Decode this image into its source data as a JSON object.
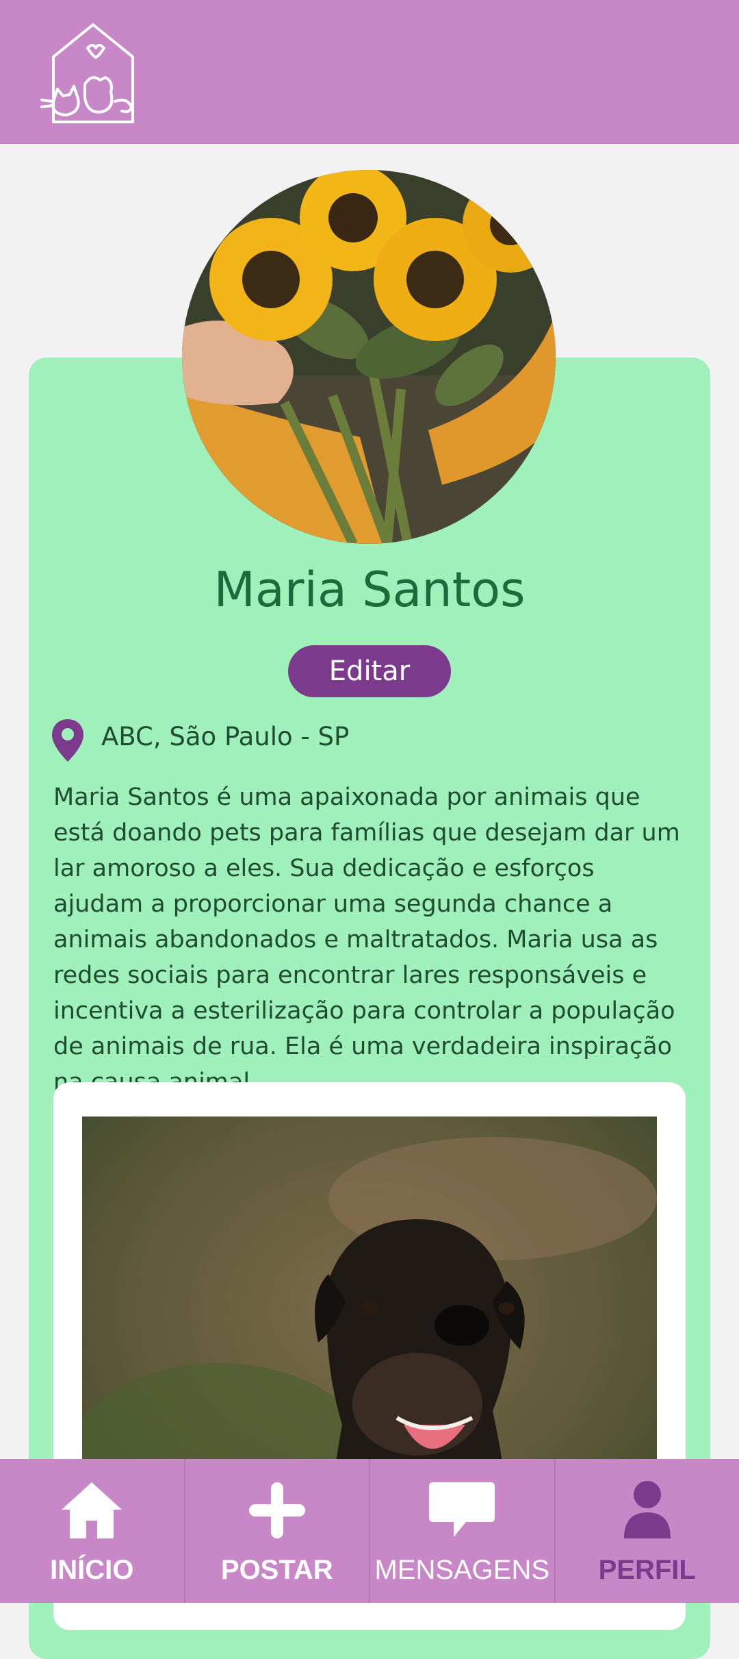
{
  "profile": {
    "name": "Maria Santos",
    "edit_label": "Editar",
    "location": "ABC, São Paulo - SP",
    "bio": "Maria Santos é uma apaixonada por animais que está doando pets para famílias que desejam dar um lar amoroso a eles. Sua dedicação e esforços ajudam a proporcionar uma segunda chance a animais abandonados e maltratados. Maria usa as redes sociais para encontrar lares responsáveis e incentiva a esterilização para controlar a população de animais de rua. Ela é uma verdadeira inspiração na causa animal."
  },
  "nav": {
    "items": [
      {
        "label": "INÍCIO",
        "icon": "home-icon"
      },
      {
        "label": "POSTAR",
        "icon": "plus-icon"
      },
      {
        "label": "MENSAGENS",
        "icon": "chat-icon"
      },
      {
        "label": "PERFIL",
        "icon": "user-icon",
        "active": true
      }
    ]
  },
  "colors": {
    "header": "#c888c8",
    "card": "#a0f0bb",
    "accent": "#7c3a8c",
    "name_text": "#1d6b3b"
  }
}
